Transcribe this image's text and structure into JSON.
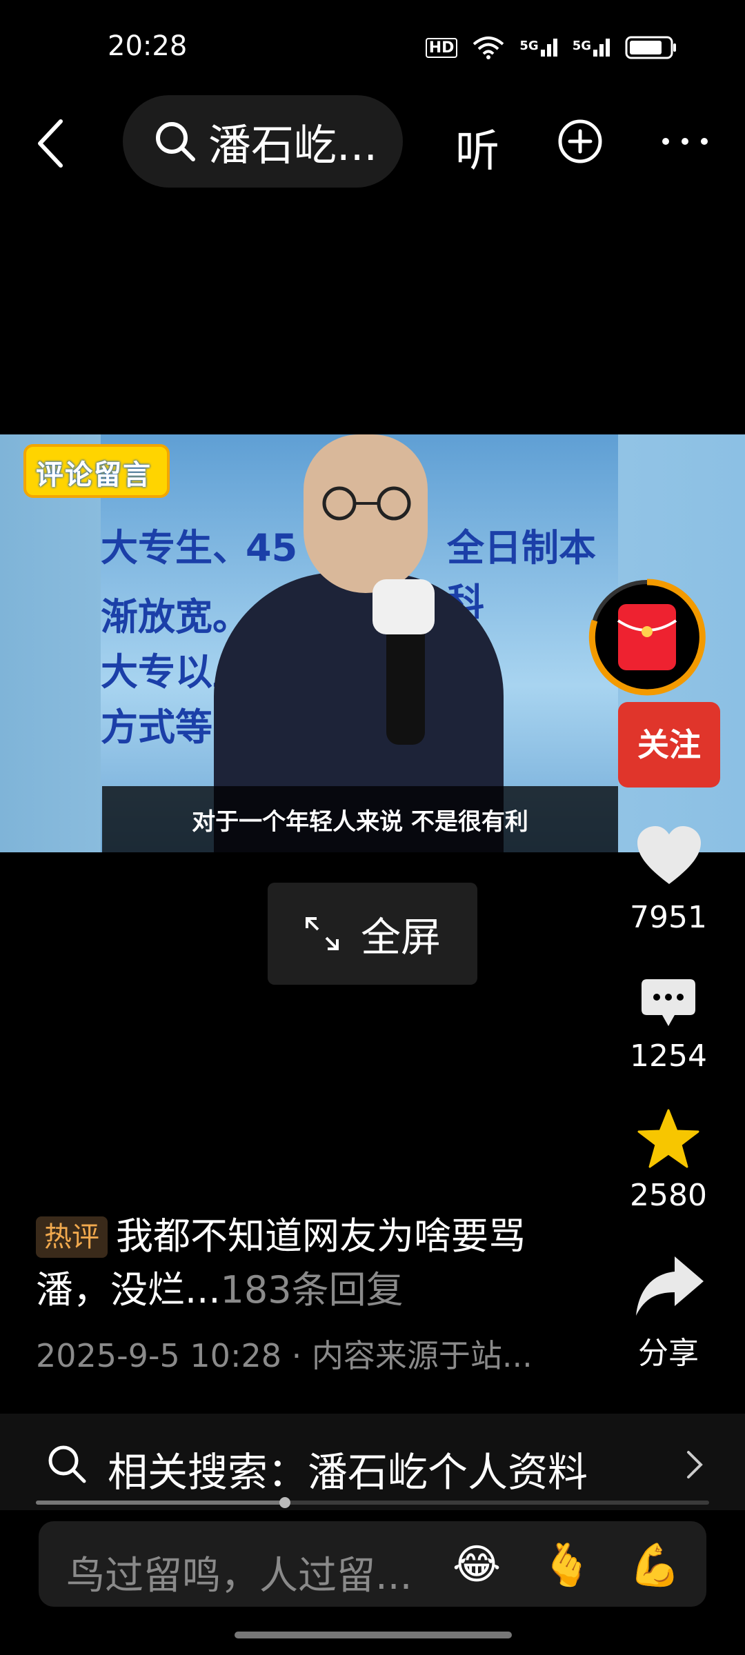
{
  "status_bar": {
    "time": "20:28",
    "hd": "HD",
    "net1": "5G",
    "net2": "5G"
  },
  "top_bar": {
    "search_text": "潘石屹...",
    "listen_label": "听"
  },
  "video": {
    "badge_text": "评论留言",
    "subtitle": "对于一个年轻人来说 不是很有利",
    "screen_lines": [
      "大专生、",
      "45 岁",
      "全日制本科",
      "渐放宽。",
      "大专以上",
      "方式等"
    ]
  },
  "right_rail": {
    "follow_label": "关注",
    "like_count": "7951",
    "comment_count": "1254",
    "favorite_count": "2580",
    "share_label": "分享"
  },
  "fullscreen_label": "全屏",
  "hot_comment": {
    "tag": "热评",
    "text": "我都不知道网友为啥要骂潘，没烂...",
    "reply_count": "183条回复",
    "meta": "2025-9-5 10:28 · 内容来源于站..."
  },
  "related_search": {
    "label": "相关搜索：潘石屹个人资料"
  },
  "progress": {
    "fraction": 0.37
  },
  "comment_input": {
    "placeholder": "鸟过留鸣，人过留...",
    "emojis": [
      "😂",
      "🫰",
      "💪"
    ]
  },
  "colors": {
    "follow": "#e0352b",
    "star": "#f7c600",
    "hot_tag": "#f1a94e"
  }
}
